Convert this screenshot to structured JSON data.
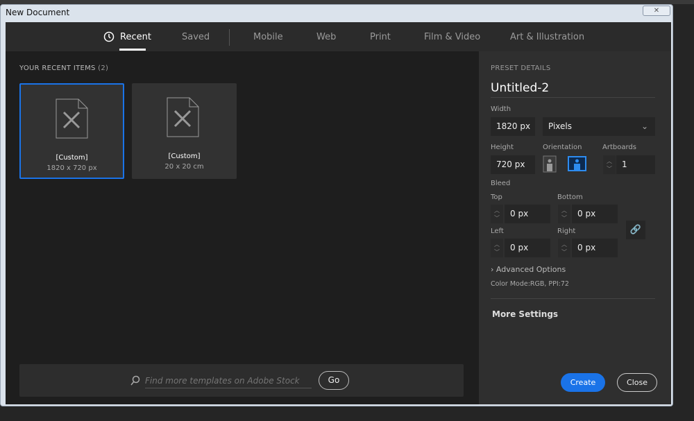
{
  "window": {
    "title": "New Document",
    "close_icon": "close-icon"
  },
  "tabs": [
    {
      "label": "Recent",
      "active": true,
      "icon": "clock-icon"
    },
    {
      "label": "Saved"
    },
    {
      "label": "Mobile"
    },
    {
      "label": "Web"
    },
    {
      "label": "Print"
    },
    {
      "label": "Film & Video"
    },
    {
      "label": "Art & Illustration"
    }
  ],
  "recent": {
    "heading": "YOUR RECENT ITEMS",
    "count": "(2)",
    "items": [
      {
        "name": "[Custom]",
        "size": "1820 x 720 px",
        "selected": true
      },
      {
        "name": "[Custom]",
        "size": "20 x 20 cm"
      }
    ]
  },
  "search": {
    "placeholder": "Find more templates on Adobe Stock",
    "go": "Go"
  },
  "preset": {
    "heading": "PRESET DETAILS",
    "name": "Untitled-2",
    "width_label": "Width",
    "width": "1820 px",
    "units": "Pixels",
    "height_label": "Height",
    "height": "720 px",
    "orientation_label": "Orientation",
    "orientation": "landscape",
    "artboards_label": "Artboards",
    "artboards": "1",
    "bleed_label": "Bleed",
    "top_label": "Top",
    "top": "0 px",
    "bottom_label": "Bottom",
    "bottom": "0 px",
    "left_label": "Left",
    "left": "0 px",
    "right_label": "Right",
    "right": "0 px",
    "advanced": "Advanced Options",
    "color_mode": "Color Mode:RGB, PPI:72",
    "more_settings": "More Settings",
    "create": "Create",
    "close": "Close"
  },
  "colors": {
    "accent": "#1a73e8"
  }
}
